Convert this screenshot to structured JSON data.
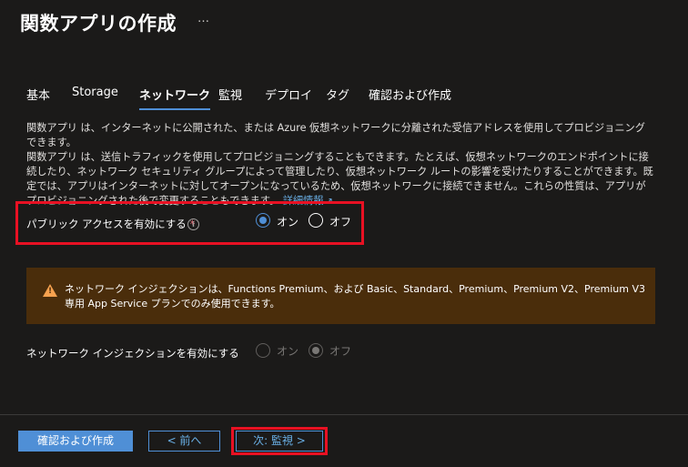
{
  "page": {
    "title": "関数アプリの作成",
    "more_label": "…"
  },
  "tabs": [
    {
      "label": "基本"
    },
    {
      "label": "Storage"
    },
    {
      "label": "ネットワーク"
    },
    {
      "label": "監視"
    },
    {
      "label": "デプロイ"
    },
    {
      "label": "タグ"
    },
    {
      "label": "確認および作成"
    }
  ],
  "description": {
    "line1": "関数アプリ は、インターネットに公開された、または Azure 仮想ネットワークに分離された受信アドレスを使用してプロビジョニングできます。",
    "line2": "関数アプリ は、送信トラフィックを使用してプロビジョニングすることもできます。たとえば、仮想ネットワークのエンドポイントに接続したり、ネットワーク セキュリティ グループによって管理したり、仮想ネットワーク ルートの影響を受けたりすることができます。既定では、アプリはインターネットに対してオープンになっているため、仮想ネットワークに接続できません。これらの性質は、アプリがプロビジョニングされた後で変更することもできます。",
    "link": "詳細情報",
    "link_icon": "external-link-icon"
  },
  "public_access": {
    "label": "パブリック アクセスを有効にする",
    "required_mark": "*",
    "info": "i",
    "options": [
      {
        "label": "オン",
        "checked": true
      },
      {
        "label": "オフ",
        "checked": false
      }
    ]
  },
  "warning": {
    "icon": "warning-icon",
    "glyph": "!",
    "text": "ネットワーク インジェクションは、Functions Premium、および Basic、Standard、Premium、Premium V2、Premium V3 専用 App Service プランでのみ使用できます。"
  },
  "network_injection": {
    "label": "ネットワーク インジェクションを有効にする",
    "options": [
      {
        "label": "オン",
        "checked": false
      },
      {
        "label": "オフ",
        "checked": true
      }
    ]
  },
  "footer": {
    "review_create": "確認および作成",
    "previous": "< 前へ",
    "next": "次: 監視 >"
  },
  "colors": {
    "background": "#1b1a19",
    "accent": "#4f8fd6",
    "highlight": "#e81123",
    "warning_bg": "#4a2d0b"
  }
}
